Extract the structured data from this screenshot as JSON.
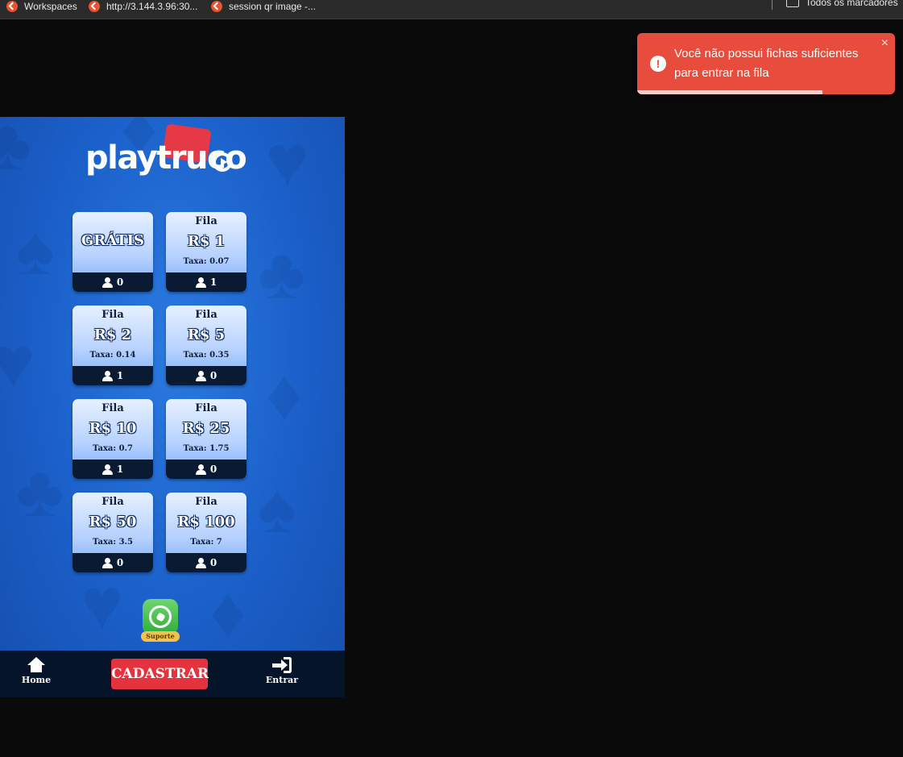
{
  "browser": {
    "bookmarks": [
      {
        "label": "Workspaces"
      },
      {
        "label": "http://3.144.3.96:30..."
      },
      {
        "label": "session qr image -..."
      }
    ],
    "all_bookmarks_label": "Todos os marcadores"
  },
  "toast": {
    "message": "Você não possui fichas suficientes para entrar na fila",
    "close_symbol": "×",
    "alert_symbol": "!",
    "color": "#e74c3c",
    "progress_fraction": 0.72
  },
  "game": {
    "logo_text": "playtruco",
    "tiles": [
      {
        "label": "",
        "price": "GRÁTIS",
        "fee": "",
        "count": "0"
      },
      {
        "label": "Fila",
        "price": "R$ 1",
        "fee": "Taxa: 0.07",
        "count": "1"
      },
      {
        "label": "Fila",
        "price": "R$ 2",
        "fee": "Taxa: 0.14",
        "count": "1"
      },
      {
        "label": "Fila",
        "price": "R$ 5",
        "fee": "Taxa: 0.35",
        "count": "0"
      },
      {
        "label": "Fila",
        "price": "R$ 10",
        "fee": "Taxa: 0.7",
        "count": "1"
      },
      {
        "label": "Fila",
        "price": "R$ 25",
        "fee": "Taxa: 1.75",
        "count": "0"
      },
      {
        "label": "Fila",
        "price": "R$ 50",
        "fee": "Taxa: 3.5",
        "count": "0"
      },
      {
        "label": "Fila",
        "price": "R$ 100",
        "fee": "Taxa: 7",
        "count": "0"
      }
    ],
    "support_label": "Suporte",
    "nav": {
      "home_label": "Home",
      "register_label": "CADASTRAR",
      "login_label": "Entrar"
    }
  }
}
